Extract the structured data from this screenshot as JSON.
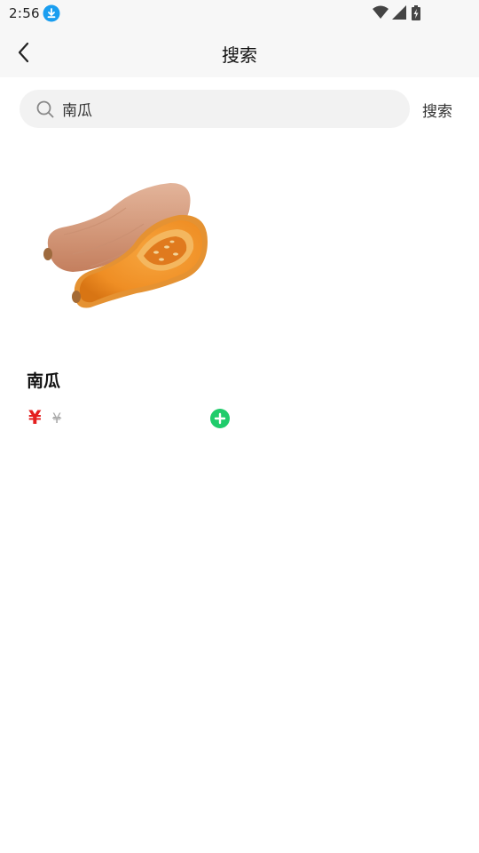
{
  "status_bar": {
    "time": "2:56",
    "icons": [
      "download-icon",
      "wifi-icon",
      "signal-icon",
      "battery-icon"
    ]
  },
  "nav": {
    "title": "搜索",
    "back_icon": "chevron-left-icon"
  },
  "search": {
    "value": "南瓜",
    "placeholder": "",
    "button_label": "搜索"
  },
  "products": [
    {
      "name": "南瓜",
      "price_symbol": "¥",
      "original_price_symbol": "¥",
      "image": "butternut-squash-image"
    }
  ],
  "colors": {
    "background": "#ffffff",
    "header": "#f7f7f7",
    "price": "#e41e1e",
    "add_button": "#1fcc6b",
    "download_badge": "#1a9ef0"
  }
}
